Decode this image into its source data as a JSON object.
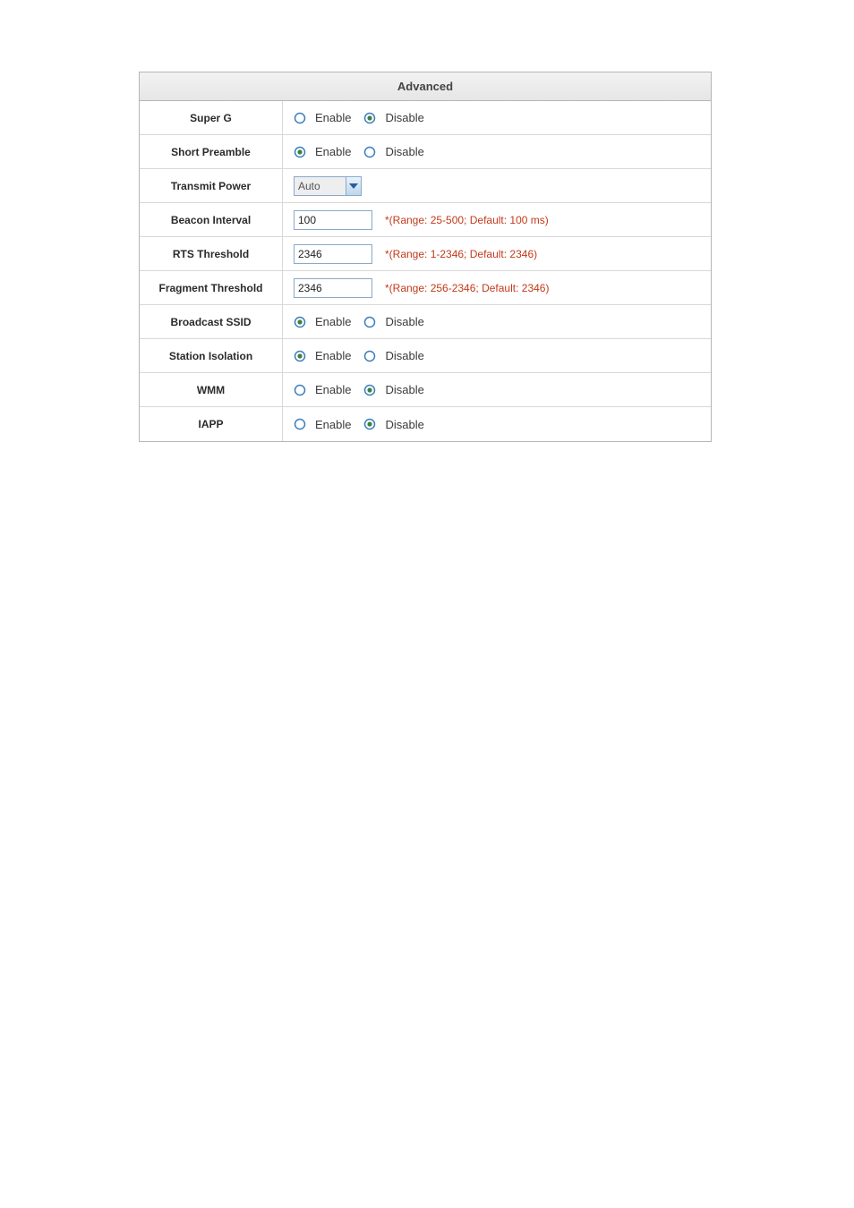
{
  "header": "Advanced",
  "labels": {
    "enable": "Enable",
    "disable": "Disable"
  },
  "rows": {
    "super_g": {
      "label": "Super G"
    },
    "short_preamble": {
      "label": "Short Preamble"
    },
    "transmit_power": {
      "label": "Transmit Power",
      "value": "Auto"
    },
    "beacon_interval": {
      "label": "Beacon Interval",
      "value": "100",
      "hint": "*(Range: 25-500; Default: 100 ms)"
    },
    "rts_threshold": {
      "label": "RTS Threshold",
      "value": "2346",
      "hint": "*(Range: 1-2346; Default: 2346)"
    },
    "fragment_threshold": {
      "label": "Fragment Threshold",
      "value": "2346",
      "hint": "*(Range: 256-2346; Default: 2346)"
    },
    "broadcast_ssid": {
      "label": "Broadcast SSID"
    },
    "station_isolation": {
      "label": "Station Isolation"
    },
    "wmm": {
      "label": "WMM"
    },
    "iapp": {
      "label": "IAPP"
    }
  }
}
